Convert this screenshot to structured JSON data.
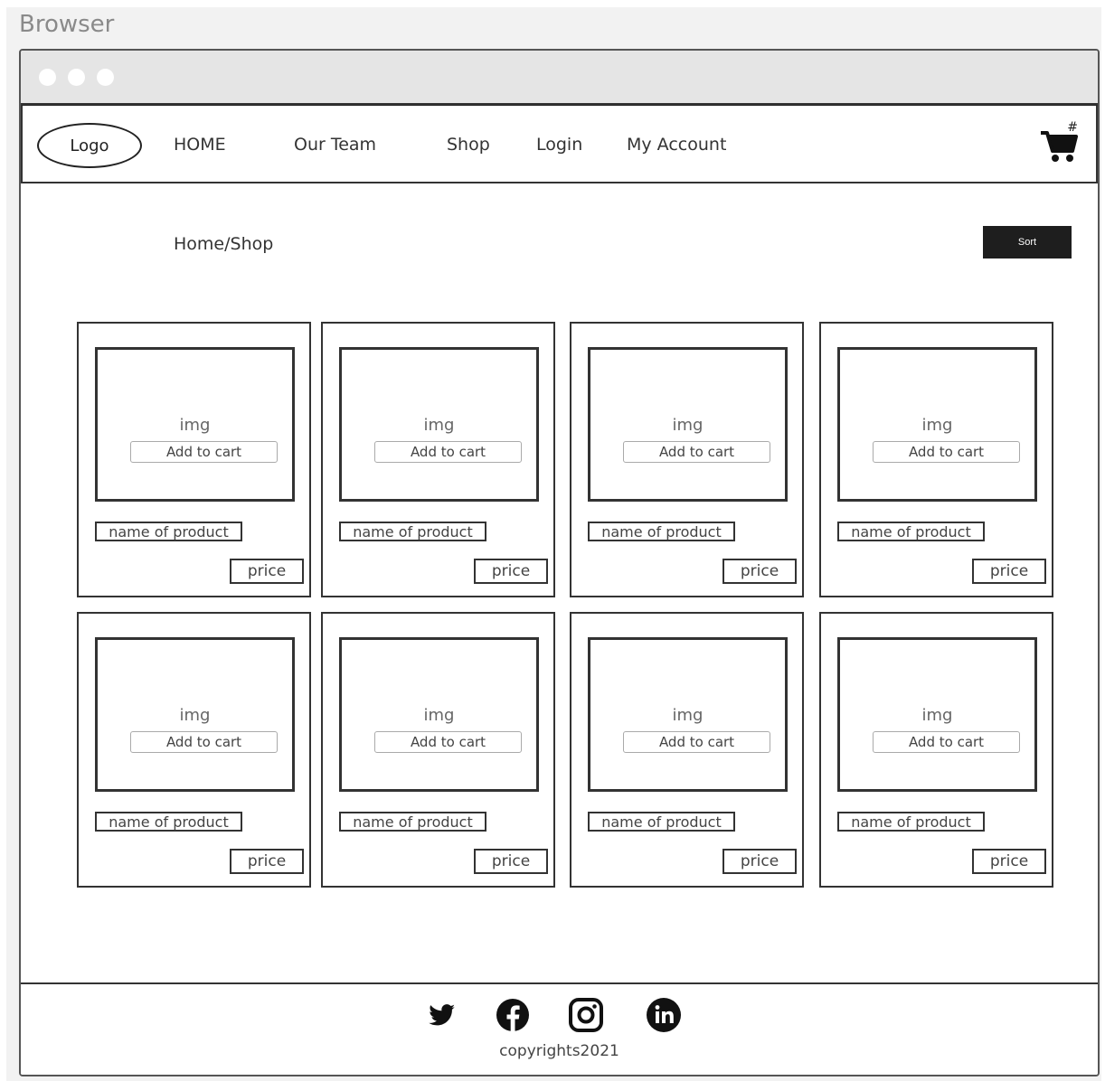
{
  "outer_title": "Browser",
  "navbar": {
    "logo": "Logo",
    "links": [
      "HOME",
      "Our Team",
      "Shop",
      "Login",
      "My Account"
    ],
    "cart_badge": "#"
  },
  "breadcrumb": "Home/Shop",
  "sort_label": "Sort",
  "products": [
    {
      "img": "img",
      "add": "Add to cart",
      "name": "name of product",
      "price": "price"
    },
    {
      "img": "img",
      "add": "Add to cart",
      "name": "name of product",
      "price": "price"
    },
    {
      "img": "img",
      "add": "Add to cart",
      "name": "name of product",
      "price": "price"
    },
    {
      "img": "img",
      "add": "Add to cart",
      "name": "name of product",
      "price": "price"
    },
    {
      "img": "img",
      "add": "Add to cart",
      "name": "name of product",
      "price": "price"
    },
    {
      "img": "img",
      "add": "Add to cart",
      "name": "name of product",
      "price": "price"
    },
    {
      "img": "img",
      "add": "Add to cart",
      "name": "name of product",
      "price": "price"
    },
    {
      "img": "img",
      "add": "Add to cart",
      "name": "name of product",
      "price": "price"
    }
  ],
  "footer": {
    "social_icons": [
      "twitter-icon",
      "facebook-icon",
      "instagram-icon",
      "linkedin-icon"
    ],
    "copyright": "copyrights2021"
  }
}
